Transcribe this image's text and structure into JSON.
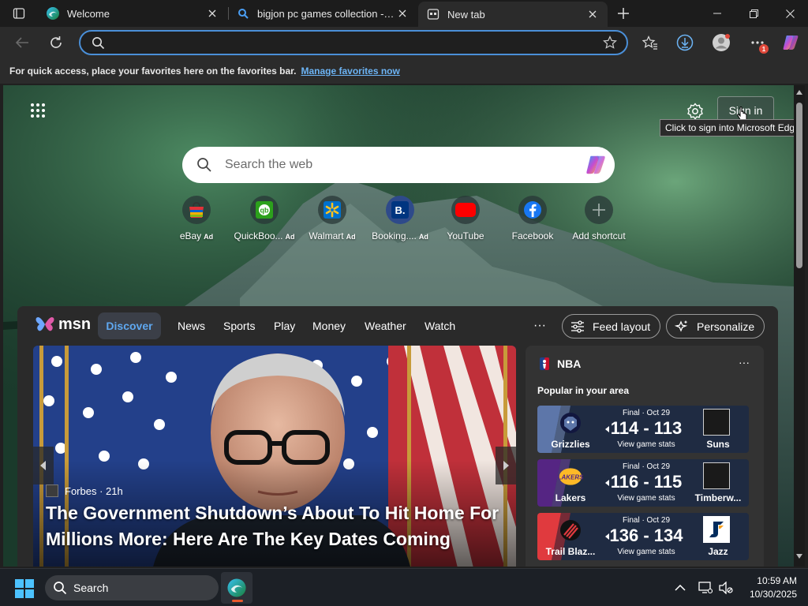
{
  "browser": {
    "tabs": [
      {
        "title": "Welcome",
        "icon": "edge-icon",
        "active": false
      },
      {
        "title": "bigjon pc games collection - Sear",
        "icon": "search-icon",
        "active": false
      },
      {
        "title": "New tab",
        "icon": "new-tab-icon",
        "active": true
      }
    ],
    "address_value": "",
    "favorites_bar": {
      "text": "For quick access, place your favorites here on the favorites bar.",
      "link": "Manage favorites now"
    },
    "notification_count": "1",
    "accent": "#4a8fd8"
  },
  "newtab": {
    "signin_label": "Sign in",
    "signin_tooltip": "Click to sign into Microsoft Edge",
    "search_placeholder": "Search the web",
    "shortcuts": [
      {
        "label": "eBay",
        "ad": "Ad",
        "icon": "ebay-icon"
      },
      {
        "label": "QuickBoo...",
        "ad": "Ad",
        "icon": "quickbooks-icon"
      },
      {
        "label": "Walmart",
        "ad": "Ad",
        "icon": "walmart-icon"
      },
      {
        "label": "Booking....",
        "ad": "Ad",
        "icon": "booking-icon"
      },
      {
        "label": "YouTube",
        "ad": "",
        "icon": "youtube-icon"
      },
      {
        "label": "Facebook",
        "ad": "",
        "icon": "facebook-icon"
      },
      {
        "label": "Add shortcut",
        "ad": "",
        "icon": "plus-icon"
      }
    ]
  },
  "feed": {
    "logo": "msn",
    "nav": [
      "Discover",
      "News",
      "Sports",
      "Play",
      "Money",
      "Weather",
      "Watch"
    ],
    "more": "···",
    "feed_layout_label": "Feed layout",
    "personalize_label": "Personalize",
    "hero": {
      "source": "Forbes",
      "age": "21h",
      "source_line": "Forbes · 21h",
      "title": "The Government Shutdown’s About To Hit Home For Millions More: Here Are The Key Dates Coming"
    },
    "nba": {
      "title": "NBA",
      "more": "···",
      "subtitle": "Popular in your area",
      "games": [
        {
          "status": "Final · Oct 29",
          "score": "114 - 113",
          "stats": "View game stats",
          "left_team": "Grizzlies",
          "right_team": "Suns",
          "left_color": "#5d76a9"
        },
        {
          "status": "Final · Oct 29",
          "score": "116 - 115",
          "stats": "View game stats",
          "left_team": "Lakers",
          "right_team": "Timberw...",
          "left_color": "#552583"
        },
        {
          "status": "Final · Oct 29",
          "score": "136 - 134",
          "stats": "View game stats",
          "left_team": "Trail Blaz...",
          "right_team": "Jazz",
          "left_color": "#e03a3e"
        }
      ]
    }
  },
  "taskbar": {
    "search_label": "Search",
    "time": "10:59 AM",
    "date": "10/30/2025"
  }
}
